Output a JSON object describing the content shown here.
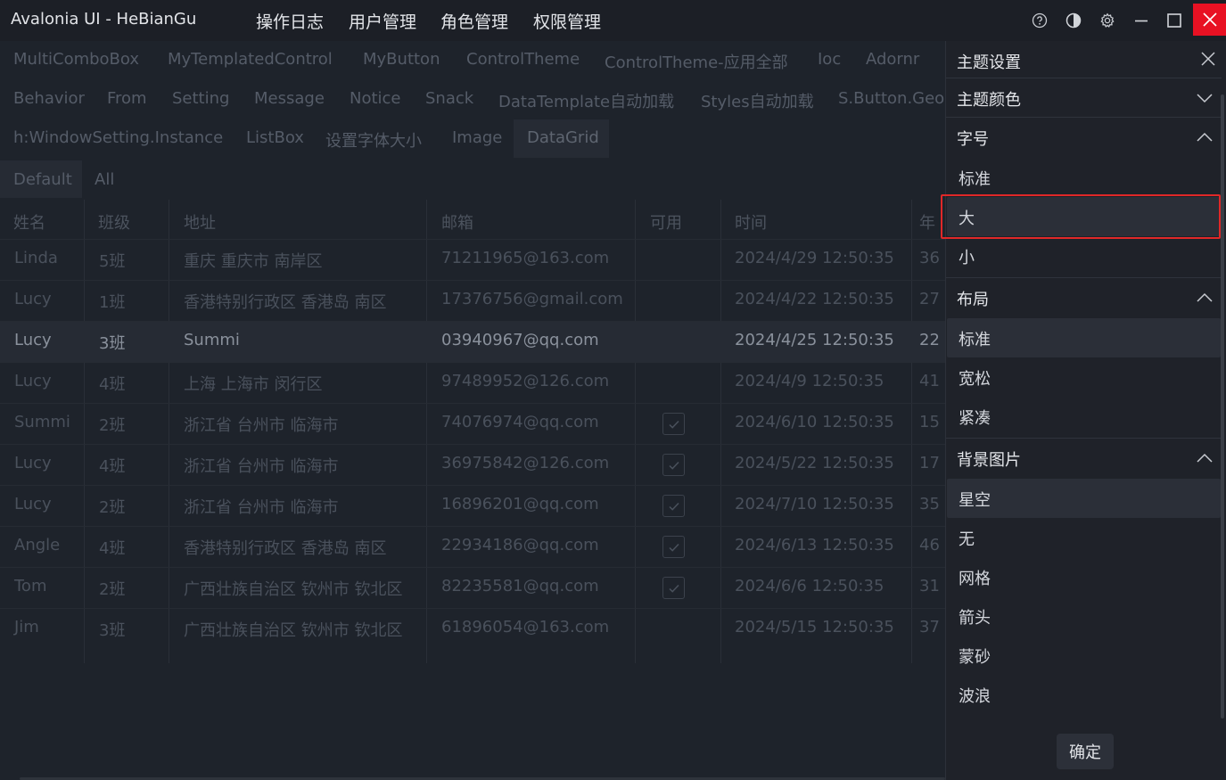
{
  "app": {
    "title": "Avalonia UI - HeBianGu"
  },
  "menu": [
    "操作日志",
    "用户管理",
    "角色管理",
    "权限管理"
  ],
  "window_buttons": [
    "help-icon",
    "theme-toggle-icon",
    "gear-icon",
    "minimize-icon",
    "maximize-icon",
    "close-icon"
  ],
  "tabs": {
    "row1": [
      "MultiComboBox",
      "MyTemplatedControl",
      "MyButton",
      "ControlTheme",
      "ControlTheme-应用全部",
      "Ioc",
      "Adornr"
    ],
    "row2": [
      "Behavior",
      "From",
      "Setting",
      "Message",
      "Notice",
      "Snack",
      "DataTemplate自动加载",
      "Styles自动加载",
      "S.Button.Geo"
    ],
    "row3": [
      "h:WindowSetting.Instance",
      "ListBox",
      "设置字体大小",
      "Image",
      "DataGrid"
    ],
    "active": "DataGrid"
  },
  "filters": [
    "Default",
    "All"
  ],
  "grid": {
    "columns": [
      "姓名",
      "班级",
      "地址",
      "邮箱",
      "可用",
      "时间",
      "年"
    ],
    "rows": [
      {
        "name": "Linda",
        "cls": "5班",
        "addr": "重庆 重庆市 南岸区",
        "email": "71211965@163.com",
        "enabled": false,
        "time": "2024/4/29 12:50:35",
        "age": "36"
      },
      {
        "name": "Lucy",
        "cls": "1班",
        "addr": "香港特别行政区 香港岛 南区",
        "email": "17376756@gmail.com",
        "enabled": false,
        "time": "2024/4/22 12:50:35",
        "age": "27"
      },
      {
        "name": "Lucy",
        "cls": "3班",
        "addr": "Summi",
        "email": "03940967@qq.com",
        "enabled": false,
        "time": "2024/4/25 12:50:35",
        "age": "22",
        "selected": true
      },
      {
        "name": "Lucy",
        "cls": "4班",
        "addr": "上海 上海市 闵行区",
        "email": "97489952@126.com",
        "enabled": false,
        "time": "2024/4/9 12:50:35",
        "age": "41"
      },
      {
        "name": "Summi",
        "cls": "2班",
        "addr": "浙江省 台州市 临海市",
        "email": "74076974@qq.com",
        "enabled": true,
        "time": "2024/6/10 12:50:35",
        "age": "15"
      },
      {
        "name": "Lucy",
        "cls": "4班",
        "addr": "浙江省 台州市 临海市",
        "email": "36975842@126.com",
        "enabled": true,
        "time": "2024/5/22 12:50:35",
        "age": "17"
      },
      {
        "name": "Lucy",
        "cls": "2班",
        "addr": "浙江省 台州市 临海市",
        "email": "16896201@qq.com",
        "enabled": true,
        "time": "2024/7/10 12:50:35",
        "age": "35"
      },
      {
        "name": "Angle",
        "cls": "4班",
        "addr": "香港特别行政区 香港岛 南区",
        "email": "22934186@qq.com",
        "enabled": true,
        "time": "2024/6/13 12:50:35",
        "age": "46"
      },
      {
        "name": "Tom",
        "cls": "2班",
        "addr": "广西壮族自治区 钦州市 钦北区",
        "email": "82235581@qq.com",
        "enabled": true,
        "time": "2024/6/6 12:50:35",
        "age": "31"
      },
      {
        "name": "Jim",
        "cls": "3班",
        "addr": "广西壮族自治区 钦州市 钦北区",
        "email": "61896054@163.com",
        "enabled": false,
        "time": "2024/5/15 12:50:35",
        "age": "37"
      }
    ]
  },
  "drawer": {
    "title": "主题设置",
    "sections": {
      "color": {
        "label": "主题颜色",
        "expanded": false
      },
      "font": {
        "label": "字号",
        "expanded": true,
        "options": [
          "标准",
          "大",
          "小"
        ],
        "selected": "大"
      },
      "layout": {
        "label": "布局",
        "expanded": true,
        "options": [
          "标准",
          "宽松",
          "紧凑"
        ],
        "selected": "标准"
      },
      "background": {
        "label": "背景图片",
        "expanded": true,
        "options": [
          "星空",
          "无",
          "网格",
          "箭头",
          "蒙砂",
          "波浪"
        ],
        "selected": "星空"
      }
    },
    "confirm_label": "确定"
  },
  "colors": {
    "close_button": "#e81123",
    "highlight": "#e02828"
  }
}
